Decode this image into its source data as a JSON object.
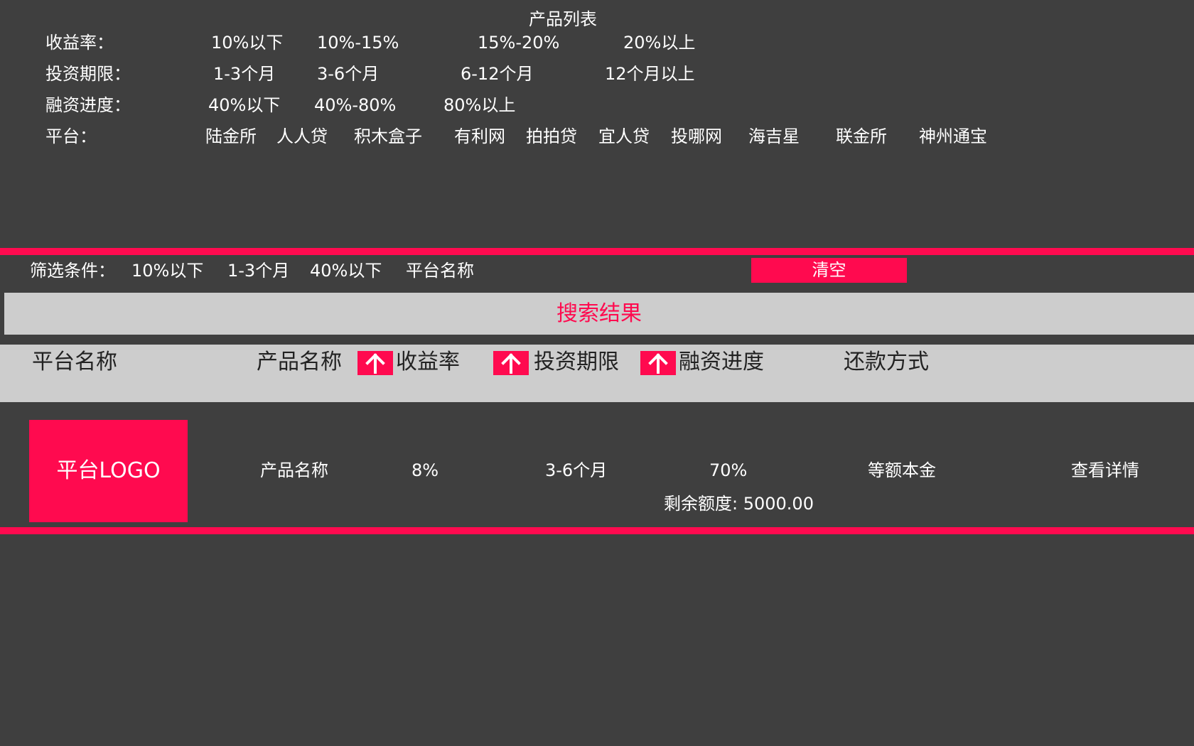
{
  "page_title": "产品列表",
  "filters": {
    "yield": {
      "label": "收益率：",
      "options": [
        "10%以下",
        "10%-15%",
        "15%-20%",
        "20%以上"
      ]
    },
    "term": {
      "label": "投资期限：",
      "options": [
        "1-3个月",
        "3-6个月",
        "6-12个月",
        "12个月以上"
      ]
    },
    "progress": {
      "label": "融资进度：",
      "options": [
        "40%以下",
        "40%-80%",
        "80%以上"
      ]
    },
    "platform": {
      "label": "平台：",
      "options": [
        "陆金所",
        "人人贷",
        "积木盒子",
        "有利网",
        "拍拍贷",
        "宜人贷",
        "投哪网",
        "海吉星",
        "联金所",
        "神州通宝"
      ]
    }
  },
  "selected": {
    "label": "筛选条件：",
    "items": [
      "10%以下",
      "1-3个月",
      "40%以下",
      "平台名称"
    ],
    "clear_label": "清空"
  },
  "results_title": "搜索结果",
  "table_header": {
    "platform": "平台名称",
    "product": "产品名称",
    "yield": "收益率",
    "term": "投资期限",
    "progress": "融资进度",
    "repayment": "还款方式"
  },
  "rows": [
    {
      "logo": "平台LOGO",
      "product": "产品名称",
      "yield": "8%",
      "term": "3-6个月",
      "progress": "70%",
      "remaining": "剩余额度: 5000.00",
      "repayment": "等额本金",
      "detail": "查看详情"
    }
  ],
  "colors": {
    "accent": "#ff0a4f",
    "background": "#3f3f3f",
    "panel": "#cdcdcd"
  },
  "icons": {
    "sort": "arrow-up-icon"
  }
}
